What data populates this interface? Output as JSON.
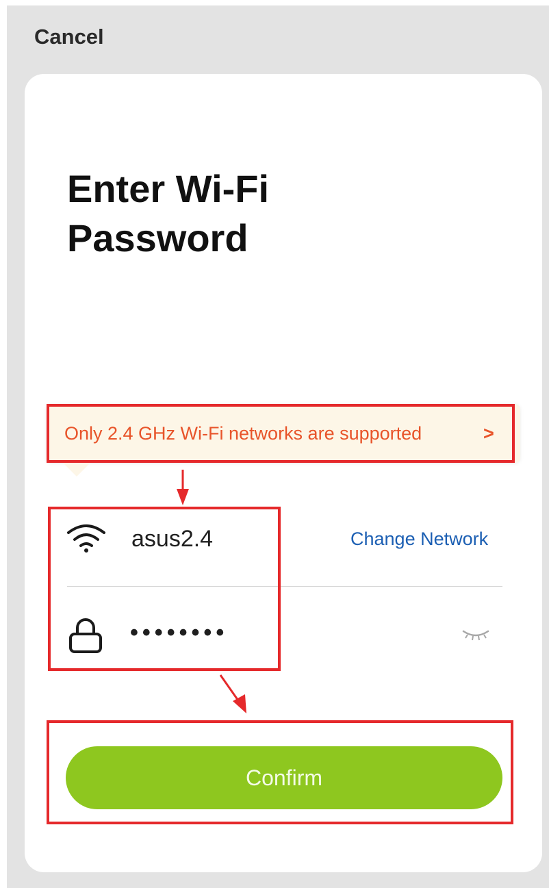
{
  "header": {
    "cancel_label": "Cancel"
  },
  "card": {
    "title_line1": "Enter Wi-Fi",
    "title_line2": "Password",
    "notice": {
      "text": "Only 2.4 GHz Wi-Fi networks are supported",
      "chevron": ">"
    },
    "network": {
      "ssid": "asus2.4",
      "change_label": "Change Network"
    },
    "password": {
      "masked_value": "••••••••"
    },
    "confirm_label": "Confirm"
  },
  "icons": {
    "network": "wifi-icon",
    "password": "lock-icon",
    "visibility": "eye-closed-icon"
  },
  "colors": {
    "accent_green": "#8ec71f",
    "link_blue": "#1c5fb3",
    "notice_orange": "#e8542a",
    "notice_bg": "#fdf6e7",
    "annotation_red": "#e5292b"
  }
}
